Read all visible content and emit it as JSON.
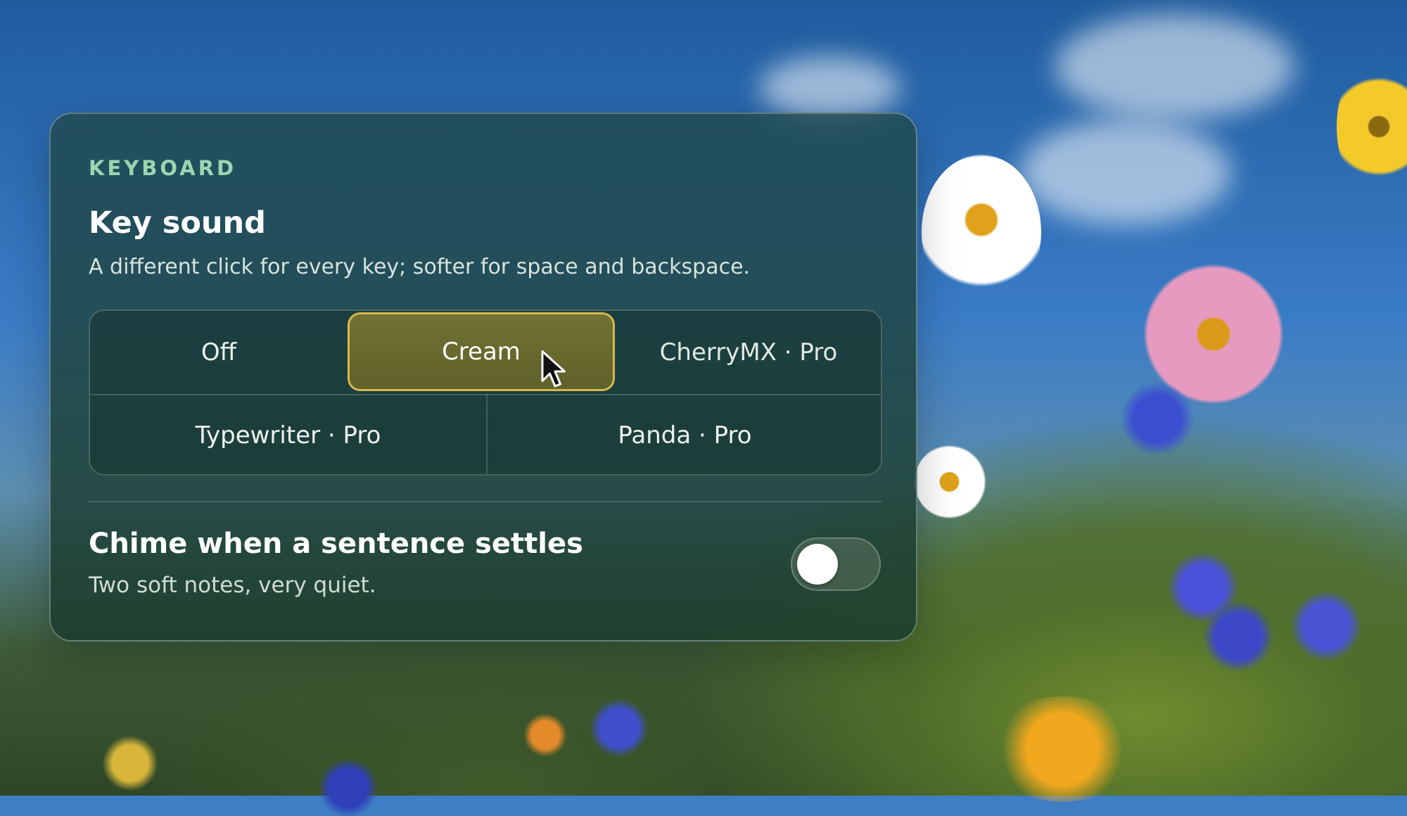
{
  "panel": {
    "section_label": "KEYBOARD",
    "key_sound": {
      "title": "Key sound",
      "description": "A different click for every key; softer for space and backspace.",
      "options": [
        {
          "label": "Off",
          "selected": false
        },
        {
          "label": "Cream",
          "selected": true
        },
        {
          "label": "CherryMX · Pro",
          "selected": false
        },
        {
          "label": "Typewriter · Pro",
          "selected": false
        },
        {
          "label": "Panda · Pro",
          "selected": false
        }
      ]
    },
    "chime": {
      "title": "Chime when a sentence settles",
      "description": "Two soft notes, very quiet.",
      "enabled": false
    }
  },
  "colors": {
    "accent_label": "#9fd4b0",
    "selected_fill": "#6e6c2e",
    "selected_border": "#d8b84d"
  },
  "icons": [
    "mouse-pointer-icon"
  ]
}
